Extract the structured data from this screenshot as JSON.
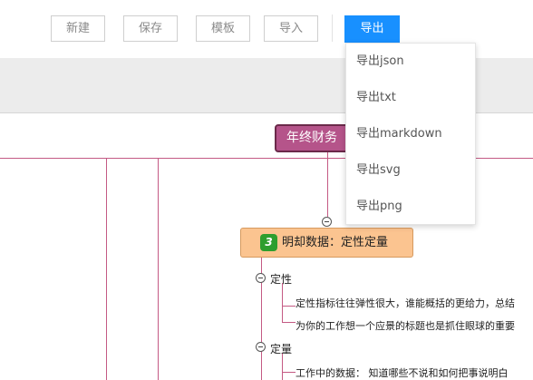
{
  "toolbar": {
    "new_label": "新建",
    "save_label": "保存",
    "template_label": "模板",
    "import_label": "导入",
    "export_label": "导出"
  },
  "export_menu": {
    "items": [
      {
        "label": "导出json"
      },
      {
        "label": "导出txt"
      },
      {
        "label": "导出markdown"
      },
      {
        "label": "导出svg"
      },
      {
        "label": "导出png"
      }
    ]
  },
  "mindmap": {
    "root_label": "年终财务",
    "main_node": {
      "number": "3",
      "label": "明却数据：定性定量"
    },
    "branches": [
      {
        "label": "定性",
        "leaves": [
          "定性指标往往弹性很大，谁能概括的更给力，总结",
          "为你的工作想一个应景的标题也是抓住眼球的重要"
        ]
      },
      {
        "label": "定量",
        "leaves": [
          "工作中的数据：  知道哪些不说和如何把事说明白"
        ]
      }
    ],
    "colors": {
      "line": "#c45a84",
      "root_fill": "#b5548a",
      "main_fill": "#fbc490",
      "badge": "#2e9e2e",
      "accent": "#1890ff"
    }
  }
}
